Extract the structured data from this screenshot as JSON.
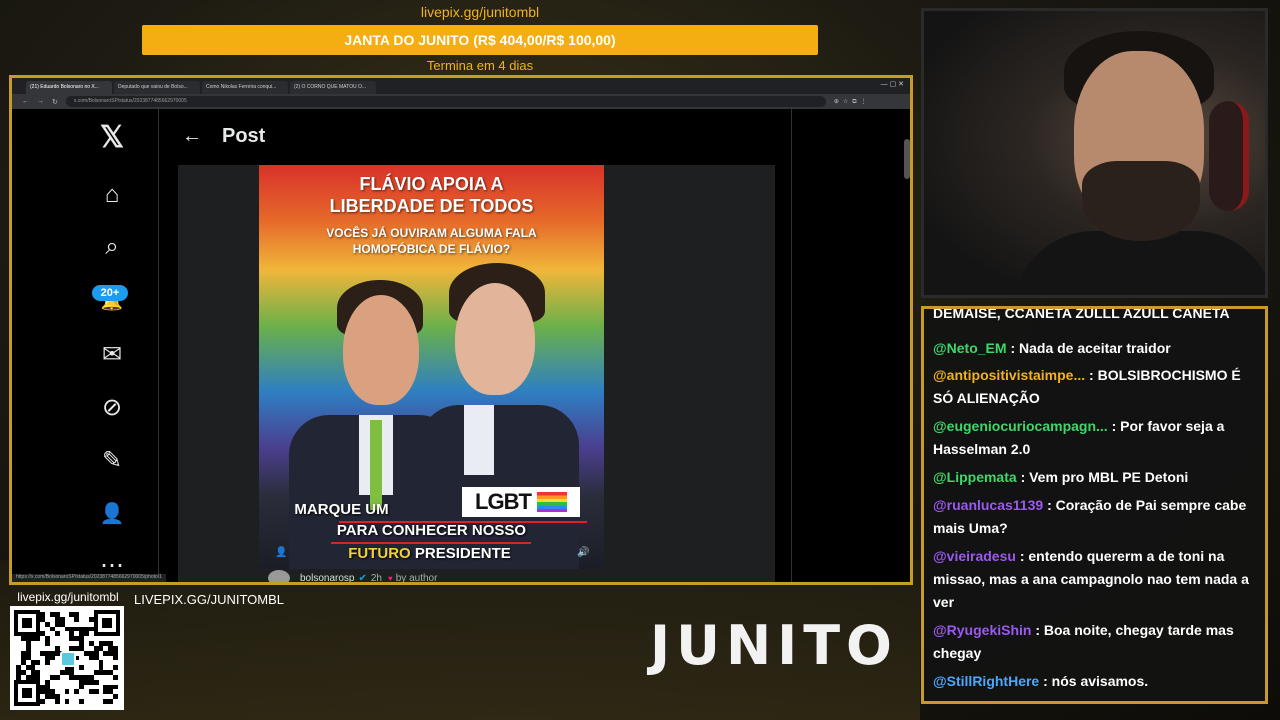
{
  "overlay": {
    "livepix_top": "livepix.gg/junitombl",
    "goal_text": "JANTA DO JUNITO (R$ 404,00/R$ 100,00)",
    "goal_progress": 1.0,
    "goal_ends": "Termina em 4 dias",
    "qr_label": "livepix.gg/junitombl",
    "livepix_url": "LIVEPIX.GG/JUNITOMBL",
    "brand": "JUNITO",
    "colors": {
      "accent": "#f5ae12",
      "frame": "#c89a28"
    }
  },
  "browser": {
    "tabs": [
      "(21) Eduardo Bolsonaro no X...",
      "Deputado que vaiou de Bolso...",
      "Como Nikolas Ferreira conqui...",
      "(2) O CORNO QUE MATOU O..."
    ],
    "url": "x.com/BolsonaroSP/status/2023877485662970005",
    "status_url": "https://x.com/BolsonaroSP/status/2023877485662970005/photo/1"
  },
  "x": {
    "nav": [
      {
        "name": "x-logo-icon",
        "glyph": "𝕏"
      },
      {
        "name": "home-icon",
        "glyph": "⌂"
      },
      {
        "name": "search-icon",
        "glyph": "⌕"
      },
      {
        "name": "notifications-icon",
        "glyph": "🔔"
      },
      {
        "name": "messages-icon",
        "glyph": "✉"
      },
      {
        "name": "grok-icon",
        "glyph": "⊘"
      },
      {
        "name": "compose-icon",
        "glyph": "✎"
      },
      {
        "name": "profile-icon",
        "glyph": "👤"
      },
      {
        "name": "more-icon",
        "glyph": "⋯"
      }
    ],
    "notif_badge": "20+",
    "post_title": "Post",
    "poster": {
      "headline_1": "FLÁVIO APOIA A",
      "headline_2": "LIBERDADE DE TODOS",
      "sub_1": "VOCÊS JÁ OUVIRAM ALGUMA FALA",
      "sub_2": "HOMOFÓBICA DE FLÁVIO?",
      "cta_1": "MARQUE UM",
      "cta_badge": "LGBT",
      "cta_2": "PARA CONHECER NOSSO",
      "cta_3a": "FUTURO",
      "cta_3b": "PRESIDENTE"
    },
    "author": {
      "handle": "bolsonarosp",
      "time": "2h",
      "liked_by": "by author"
    }
  },
  "chat": [
    {
      "user": "",
      "text": "DEMAISE, CCANETA ZULLL AZULL CANETA",
      "color": "#ffffff"
    },
    {
      "user": "@Neto_EM",
      "text": ": Nada de aceitar traidor",
      "color": "#3fd66b"
    },
    {
      "user": "@antipositivistaimpe...",
      "text": ": BOLSIBROCHISMO É SÓ ALIENAÇÃO",
      "color": "#f0b31a"
    },
    {
      "user": "@eugeniocuriocampagn...",
      "text": ": Por favor seja a Hasselman 2.0",
      "color": "#3fd66b"
    },
    {
      "user": "@Lippemata",
      "text": ": Vem pro MBL PE Detoni",
      "color": "#3fd66b"
    },
    {
      "user": "@ruanlucas1139",
      "text": ": Coração de Pai sempre cabe mais Uma?",
      "color": "#9b59f0"
    },
    {
      "user": "@vieiradesu",
      "text": ": entendo quererm a de toni na missao, mas a ana campagnolo nao tem nada a ver",
      "color": "#9b59f0"
    },
    {
      "user": "@RyugekiShin",
      "text": ": Boa noite, chegay tarde mas chegay",
      "color": "#9b59f0"
    },
    {
      "user": "@StillRightHere",
      "text": ": nós avisamos.",
      "color": "#4aa8ff"
    }
  ]
}
